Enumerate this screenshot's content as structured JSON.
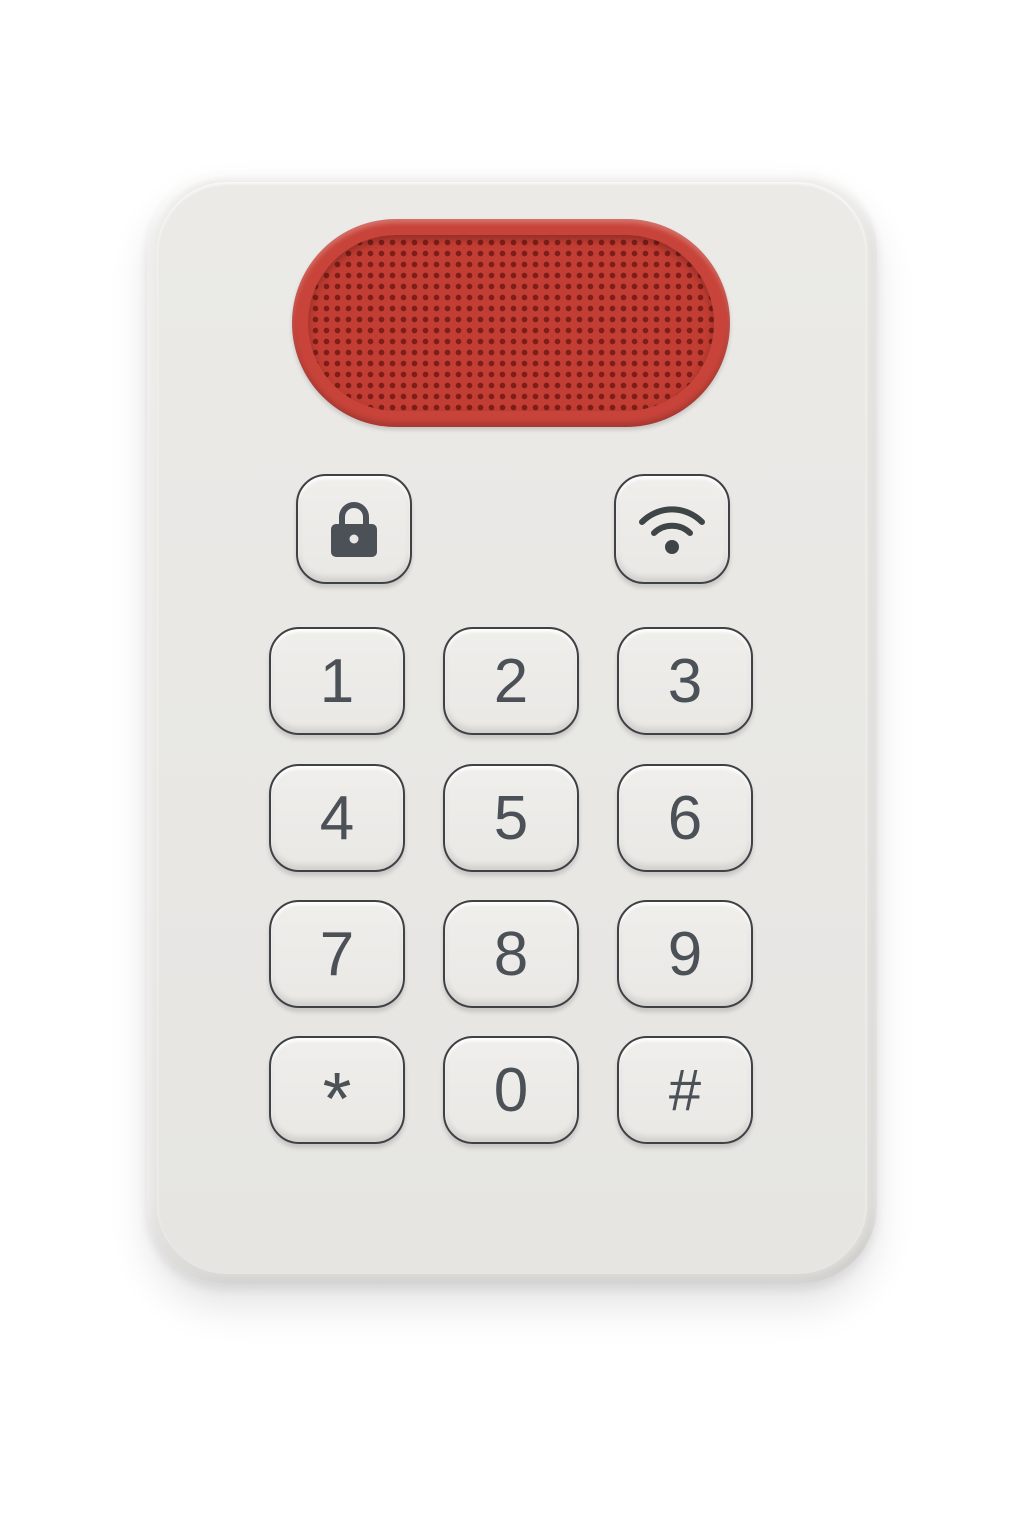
{
  "device": {
    "body_color": "#e9e8e5",
    "accent_color": "#c8443a",
    "speaker_icon": "speaker-grille",
    "function_keys": [
      {
        "icon": "lock-icon"
      },
      {
        "icon": "wifi-icon"
      }
    ],
    "keys": [
      {
        "label": "1"
      },
      {
        "label": "2"
      },
      {
        "label": "3"
      },
      {
        "label": "4"
      },
      {
        "label": "5"
      },
      {
        "label": "6"
      },
      {
        "label": "7"
      },
      {
        "label": "8"
      },
      {
        "label": "9"
      },
      {
        "label": "*"
      },
      {
        "label": "0"
      },
      {
        "label": "#"
      }
    ]
  }
}
